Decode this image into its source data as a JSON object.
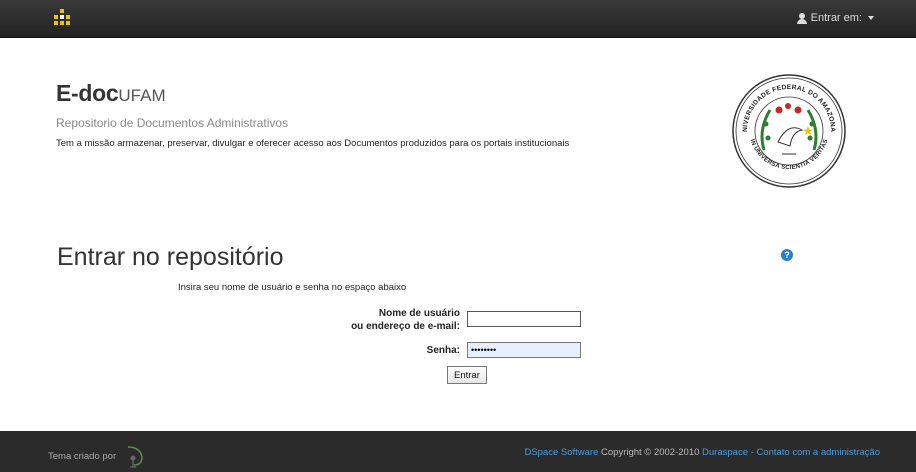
{
  "navbar": {
    "login_label": "Entrar em:"
  },
  "header": {
    "title_main": "E-doc",
    "title_suffix": "UFAM",
    "subtitle": "Repositorio de Documentos Administrativos",
    "mission": "Tem a missão armazenar, preservar, divulgar e oferecer acesso aos Documentos produzidos para os portais institucionais",
    "seal": {
      "top_text": "UNIVERSIDADE FEDERAL DO AMAZONAS",
      "bottom_text": "IN UNIVERSA SCIENTIA VERITAS"
    }
  },
  "login": {
    "heading": "Entrar no repositório",
    "help_glyph": "?",
    "instructions": "Insira seu nome de usuário e senha no espaço abaixo",
    "username_label_line1": "Nome de usuário",
    "username_label_line2": "ou endereço de e-mail:",
    "username_value": "",
    "password_label": "Senha:",
    "password_value": "••••••••",
    "submit_label": "Entrar"
  },
  "footer": {
    "theme_credit": "Tema criado por",
    "dspace_link": "DSpace Software",
    "copyright": " Copyright © 2002-2010 ",
    "duraspace_link": "Duraspace",
    "separator": " - ",
    "contact_link": "Contato com a administração"
  },
  "colors": {
    "navbar_bg": "#222222",
    "link": "#4b9ddf",
    "brand_accent": "#f2c200",
    "help_icon": "#2a7fc9"
  }
}
